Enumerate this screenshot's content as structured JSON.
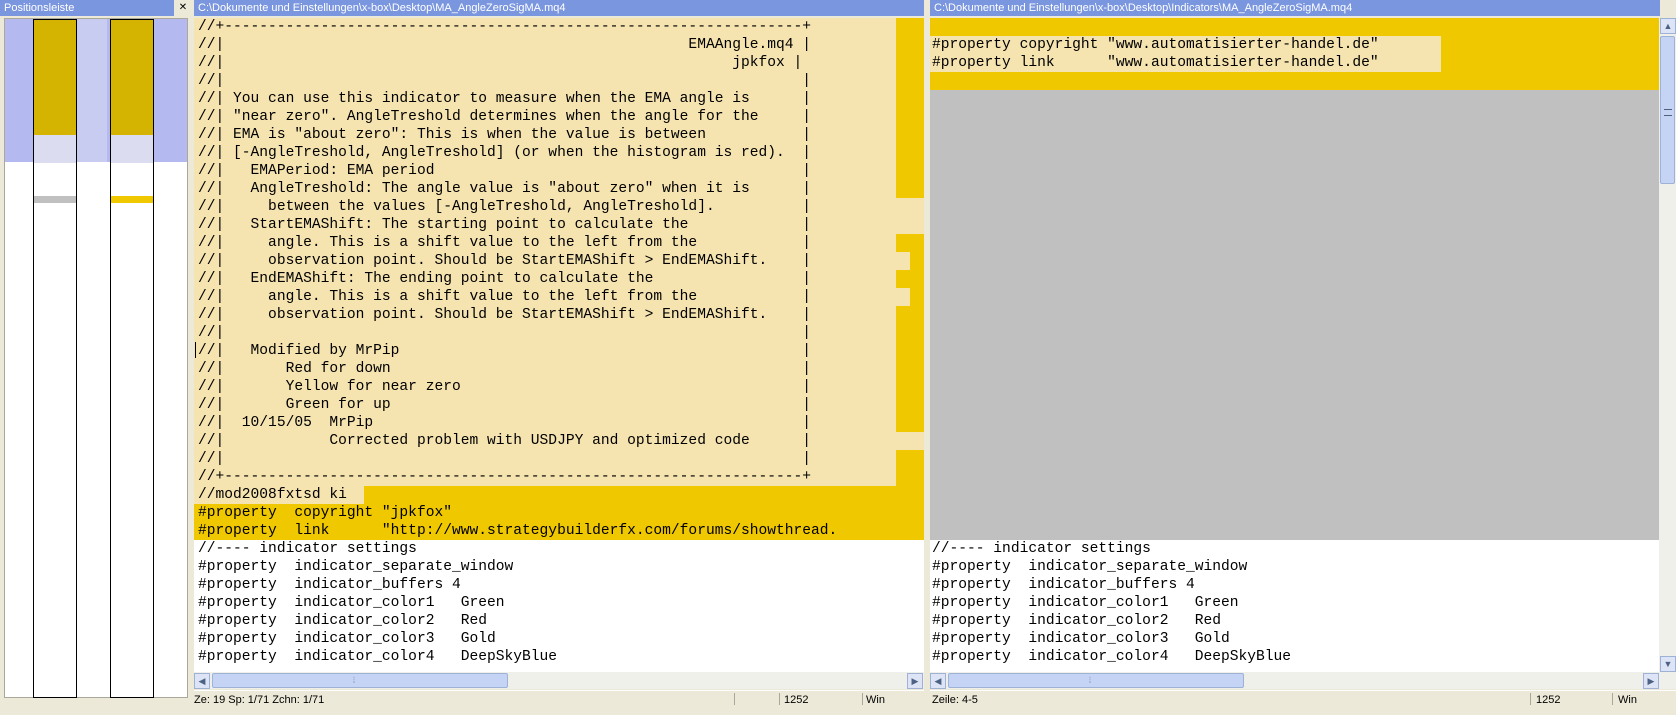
{
  "position_bar": {
    "title": "Positionsleiste",
    "close": "✕"
  },
  "left_editor": {
    "path": "C:\\Dokumente und Einstellungen\\x-box\\Desktop\\MA_AngleZeroSigMA.mq4",
    "lines": [
      "//+------------------------------------------------------------------+",
      "//|                                                     EMAAngle.mq4 |",
      "//|                                                          jpkfox |",
      "//|                                                                  |",
      "//| You can use this indicator to measure when the EMA angle is      |",
      "//| \"near zero\". AngleTreshold determines when the angle for the     |",
      "//| EMA is \"about zero\": This is when the value is between           |",
      "//| [-AngleTreshold, AngleTreshold] (or when the histogram is red).  |",
      "//|   EMAPeriod: EMA period                                          |",
      "//|   AngleTreshold: The angle value is \"about zero\" when it is      |",
      "//|     between the values [-AngleTreshold, AngleTreshold].          |",
      "//|   StartEMAShift: The starting point to calculate the             |",
      "//|     angle. This is a shift value to the left from the            |",
      "//|     observation point. Should be StartEMAShift > EndEMAShift.    |",
      "//|   EndEMAShift: The ending point to calculate the                 |",
      "//|     angle. This is a shift value to the left from the            |",
      "//|     observation point. Should be StartEMAShift > EndEMAShift.    |",
      "//|                                                                  |",
      "//|   Modified by MrPip                                              |",
      "//|       Red for down                                               |",
      "//|       Yellow for near zero                                       |",
      "//|       Green for up                                               |",
      "//|  10/15/05  MrPip                                                 |",
      "//|            Corrected problem with USDJPY and optimized code      |",
      "//|                                                                  |",
      "//+------------------------------------------------------------------+",
      "//mod2008fxtsd ki",
      "#property  copyright \"jpkfox\"",
      "#property  link      \"http://www.strategybuilderfx.com/forums/showthread.",
      "//---- indicator settings",
      "#property  indicator_separate_window",
      "#property  indicator_buffers 4",
      "#property  indicator_color1   Green",
      "#property  indicator_color2   Red",
      "#property  indicator_color3   Gold",
      "#property  indicator_color4   DeepSkyBlue"
    ],
    "status": {
      "position": "Ze: 19  Sp: 1/71  Zchn: 1/71",
      "codepage": "1252",
      "format": "Win"
    }
  },
  "right_editor": {
    "path": "C:\\Dokumente und Einstellungen\\x-box\\Desktop\\Indicators\\MA_AngleZeroSigMA.mq4",
    "top_lines": [
      "",
      "#property copyright \"www.automatisierter-handel.de\"",
      "#property link      \"www.automatisierter-handel.de\"",
      ""
    ],
    "bottom_lines": [
      "//---- indicator settings",
      "#property  indicator_separate_window",
      "#property  indicator_buffers 4",
      "#property  indicator_color1   Green",
      "#property  indicator_color2   Red",
      "#property  indicator_color3   Gold",
      "#property  indicator_color4   DeepSkyBlue"
    ],
    "status": {
      "position": "Zeile: 4-5",
      "codepage": "1252",
      "format": "Win"
    }
  },
  "scroll": {
    "left_arrow": "◀",
    "right_arrow": "▶",
    "up_arrow": "▲",
    "down_arrow": "▼",
    "grip": "⦙"
  },
  "colors": {
    "highlight": "#f0c800",
    "comment_box": "#f5e3b0",
    "gray_block": "#c0c0c0",
    "titlebar": "#7a96df"
  }
}
